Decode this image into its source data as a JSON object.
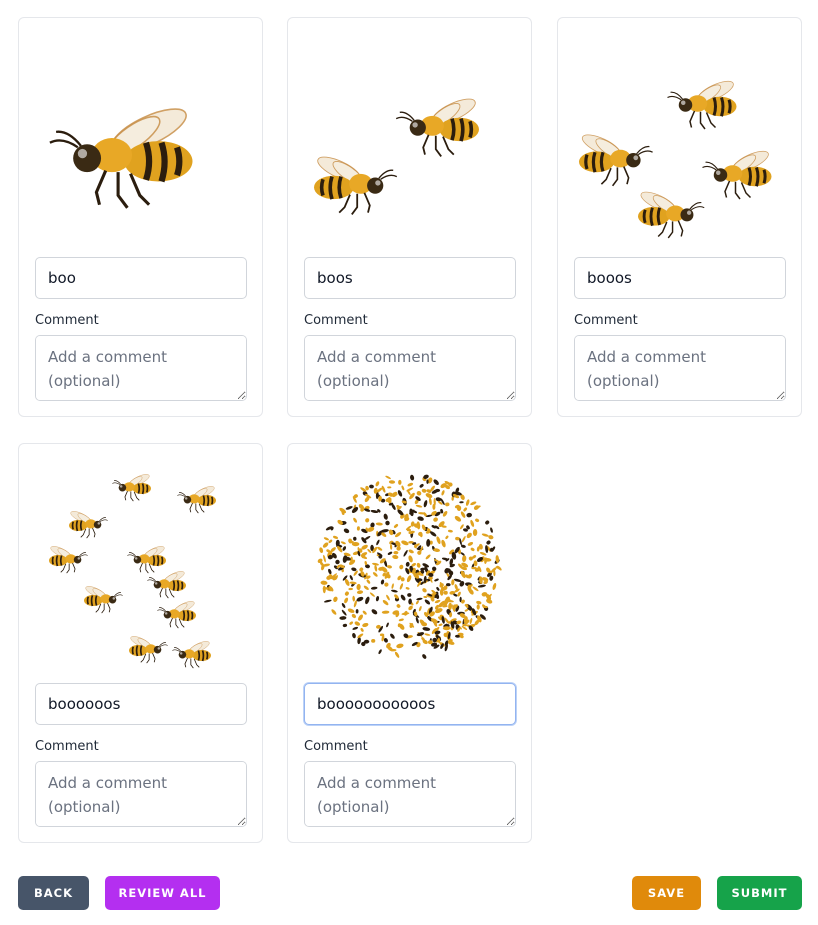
{
  "cards": [
    {
      "name_value": "boo",
      "comment_label": "Comment",
      "comment_placeholder": "Add a comment\n(optional)",
      "image_icon": "single-bee-icon",
      "focused": false
    },
    {
      "name_value": "boos",
      "comment_label": "Comment",
      "comment_placeholder": "Add a comment\n(optional)",
      "image_icon": "two-bees-icon",
      "focused": false
    },
    {
      "name_value": "booos",
      "comment_label": "Comment",
      "comment_placeholder": "Add a comment\n(optional)",
      "image_icon": "four-bees-icon",
      "focused": false
    },
    {
      "name_value": "boooooos",
      "comment_label": "Comment",
      "comment_placeholder": "Add a comment\n(optional)",
      "image_icon": "bee-group-icon",
      "focused": false
    },
    {
      "name_value": "booooooooooos",
      "comment_label": "Comment",
      "comment_placeholder": "Add a comment\n(optional)",
      "image_icon": "bee-swarm-icon",
      "focused": true
    }
  ],
  "actions": {
    "back_label": "BACK",
    "review_all_label": "REVIEW ALL",
    "save_label": "SAVE",
    "submit_label": "SUBMIT"
  },
  "colors": {
    "back": "#475569",
    "review_all": "#b42ff0",
    "save": "#e08a0b",
    "submit": "#16a34a",
    "bee_body": "#e0a21f",
    "bee_stripe": "#2b1d0e"
  }
}
